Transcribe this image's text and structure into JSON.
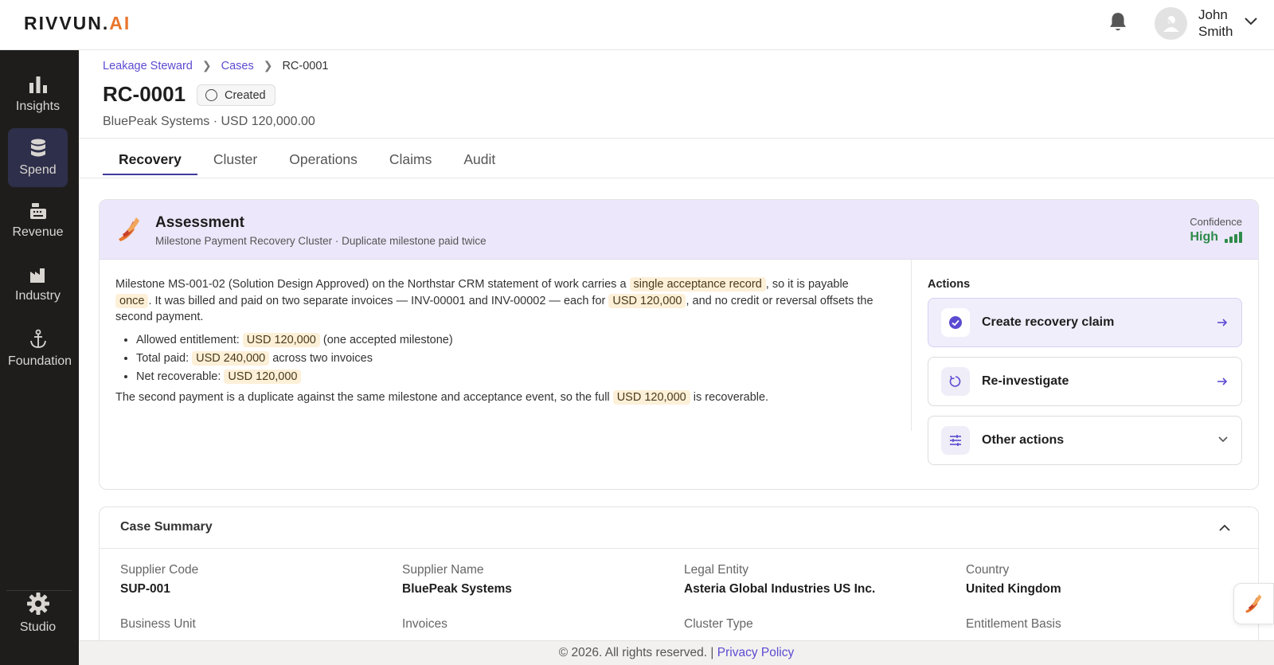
{
  "app": {
    "logo_main": "RIVVUN.",
    "logo_accent": "AI",
    "user_first": "John",
    "user_last": "Smith"
  },
  "sidebar": {
    "items": [
      {
        "label": "Insights",
        "icon": "bar-chart-icon"
      },
      {
        "label": "Spend",
        "icon": "database-icon",
        "active": true
      },
      {
        "label": "Revenue",
        "icon": "cash-register-icon"
      },
      {
        "label": "Industry",
        "icon": "factory-icon"
      },
      {
        "label": "Foundation",
        "icon": "anchor-icon"
      }
    ],
    "bottom": {
      "label": "Studio",
      "icon": "gear-icon"
    }
  },
  "breadcrumb": [
    "Leakage Steward",
    "Cases",
    "RC-0001"
  ],
  "page": {
    "title": "RC-0001",
    "status": "Created",
    "subtitle": "BluePeak Systems · USD 120,000.00"
  },
  "tabs": [
    "Recovery",
    "Cluster",
    "Operations",
    "Claims",
    "Audit"
  ],
  "assessment": {
    "title": "Assessment",
    "subtitle": "Milestone Payment Recovery Cluster · Duplicate milestone paid twice",
    "confidence_label": "Confidence",
    "confidence_value": "High",
    "p1_a": "Milestone MS-001-02 (Solution Design Approved) on the Northstar CRM statement of work carries a",
    "p1_hl1": "single acceptance record",
    "p1_b": ", so it is payable",
    "p1_hl2": "once",
    "p1_c": ". It was billed and paid on two separate invoices — INV-00001 and INV-00002 — each for",
    "p1_hl3": "USD 120,000",
    "p1_d": ", and no credit or reversal offsets the second payment.",
    "bullets": [
      {
        "pre": "Allowed entitlement:",
        "hl": "USD 120,000",
        "post": "(one accepted milestone)"
      },
      {
        "pre": "Total paid:",
        "hl": "USD 240,000",
        "post": "across two invoices"
      },
      {
        "pre": "Net recoverable:",
        "hl": "USD 120,000",
        "post": ""
      }
    ],
    "p2_a": "The second payment is a duplicate against the same milestone and acceptance event, so the full",
    "p2_hl": "USD 120,000",
    "p2_b": "is recoverable."
  },
  "actions": {
    "title": "Actions",
    "create": "Create recovery claim",
    "reinvestigate": "Re-investigate",
    "other": "Other actions"
  },
  "summary": {
    "title": "Case Summary",
    "fields": [
      {
        "label": "Supplier Code",
        "value": "SUP-001"
      },
      {
        "label": "Supplier Name",
        "value": "BluePeak Systems"
      },
      {
        "label": "Legal Entity",
        "value": "Asteria Global Industries US Inc."
      },
      {
        "label": "Country",
        "value": "United Kingdom"
      },
      {
        "label": "Business Unit",
        "value": ""
      },
      {
        "label": "Invoices",
        "value": ""
      },
      {
        "label": "Cluster Type",
        "value": ""
      },
      {
        "label": "Entitlement Basis",
        "value": ""
      }
    ]
  },
  "footer": {
    "text": "© 2026. All rights reserved. |",
    "link": "Privacy Policy"
  },
  "colors": {
    "accent": "#5b4bd1",
    "sidebar_bg": "#1f1d1c",
    "confidence_green": "#2e8b4a",
    "highlight_bg": "#fdf0d8",
    "assessment_head_bg": "#ece7fa"
  }
}
